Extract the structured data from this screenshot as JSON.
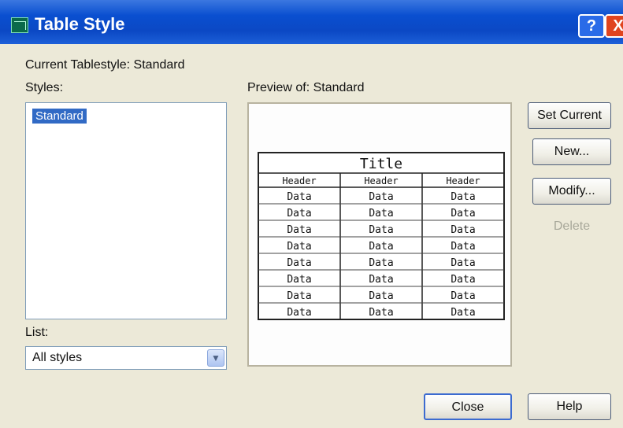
{
  "window": {
    "title": "Table Style",
    "help_glyph": "?",
    "close_glyph": "X"
  },
  "current_tablestyle_label": "Current Tablestyle: Standard",
  "styles": {
    "label": "Styles:",
    "items": [
      "Standard"
    ]
  },
  "list": {
    "label": "List:",
    "selected": "All styles"
  },
  "preview": {
    "label": "Preview of: Standard",
    "title": "Title",
    "headers": [
      "Header",
      "Header",
      "Header"
    ],
    "rows": [
      [
        "Data",
        "Data",
        "Data"
      ],
      [
        "Data",
        "Data",
        "Data"
      ],
      [
        "Data",
        "Data",
        "Data"
      ],
      [
        "Data",
        "Data",
        "Data"
      ],
      [
        "Data",
        "Data",
        "Data"
      ],
      [
        "Data",
        "Data",
        "Data"
      ],
      [
        "Data",
        "Data",
        "Data"
      ],
      [
        "Data",
        "Data",
        "Data"
      ]
    ]
  },
  "buttons": {
    "set_current": "Set Current",
    "new": "New...",
    "modify": "Modify...",
    "delete": "Delete",
    "close": "Close",
    "help": "Help"
  },
  "colors": {
    "titlebar": "#0b48c4",
    "selection": "#316ac5",
    "dialog_bg": "#ece9d8"
  }
}
